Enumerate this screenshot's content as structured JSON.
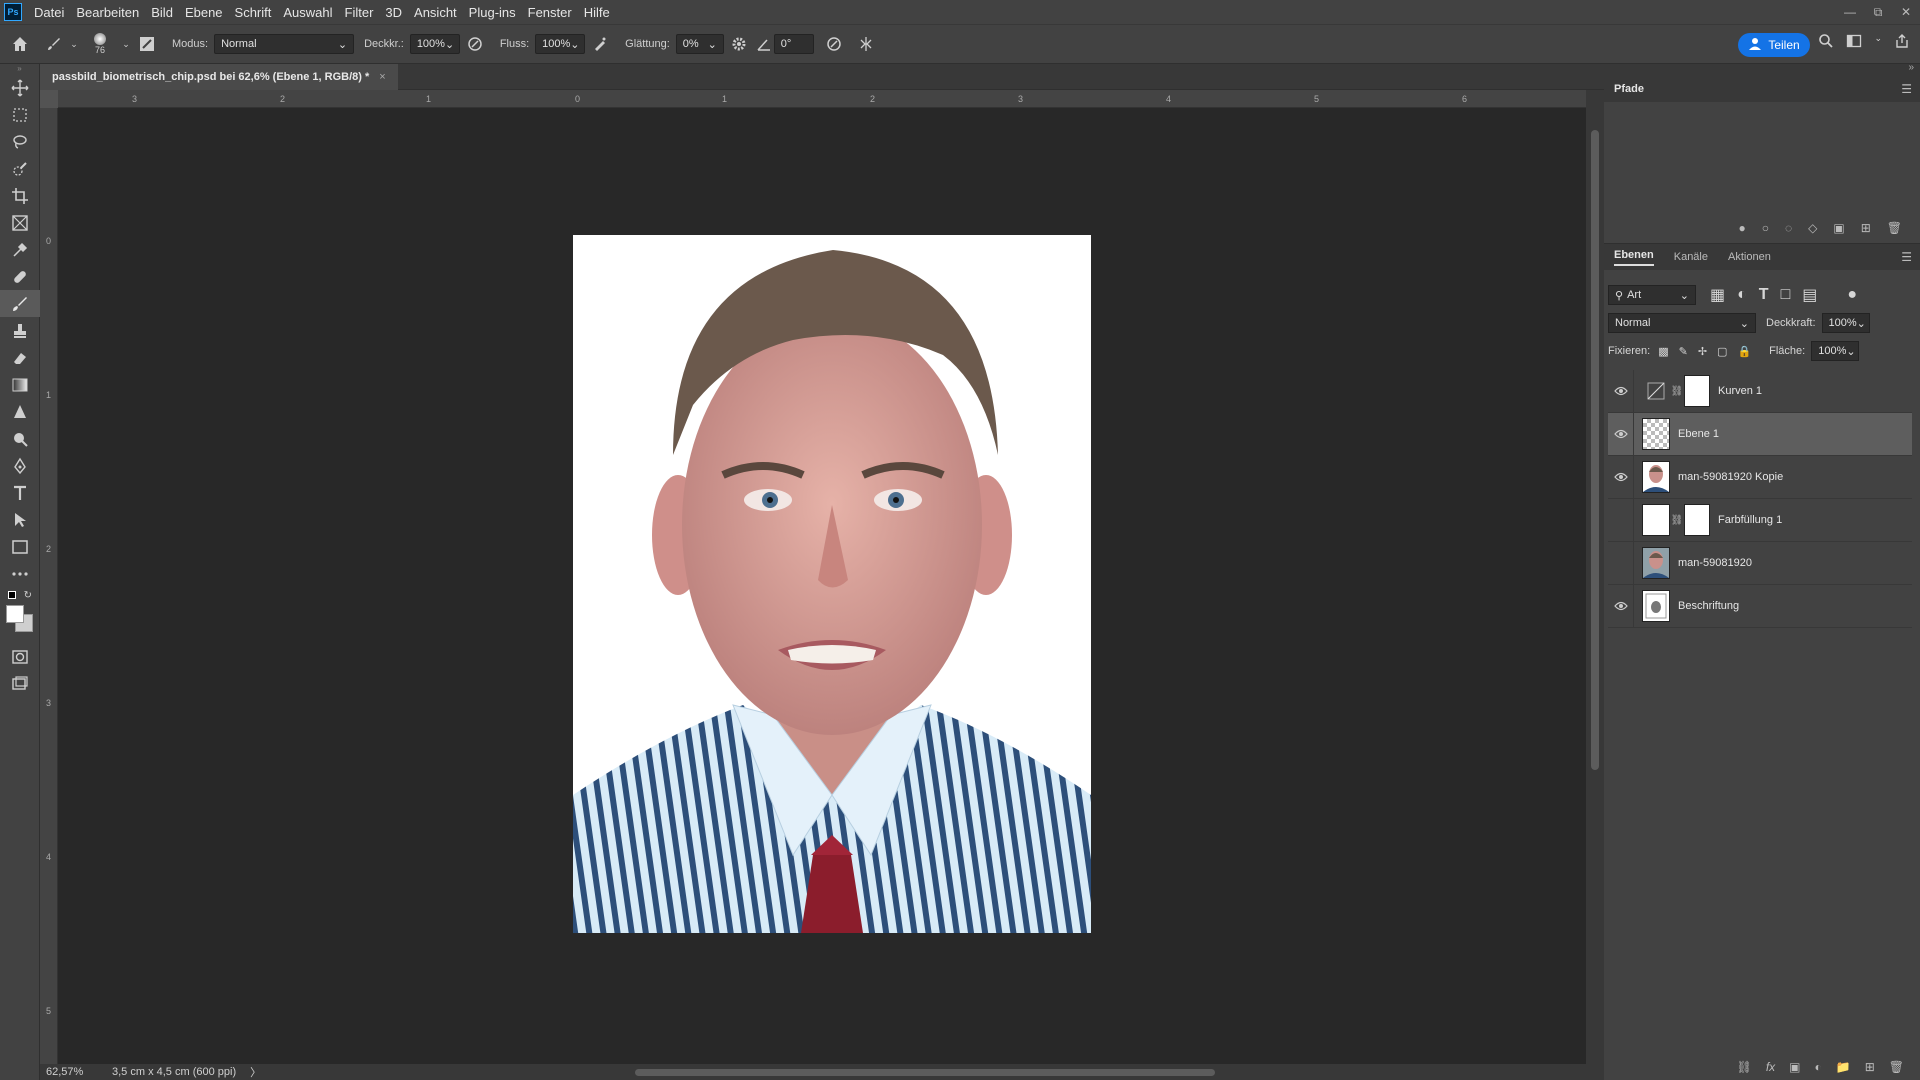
{
  "app": {
    "logo": "Ps"
  },
  "menu": [
    "Datei",
    "Bearbeiten",
    "Bild",
    "Ebene",
    "Schrift",
    "Auswahl",
    "Filter",
    "3D",
    "Ansicht",
    "Plug-ins",
    "Fenster",
    "Hilfe"
  ],
  "options": {
    "brush_size": "76",
    "mode_label": "Modus:",
    "mode_value": "Normal",
    "opacity_label": "Deckkr.:",
    "opacity_value": "100%",
    "flow_label": "Fluss:",
    "flow_value": "100%",
    "smoothing_label": "Glättung:",
    "smoothing_value": "0%",
    "angle_value": "0°",
    "share_label": "Teilen"
  },
  "document": {
    "tab_title": "passbild_biometrisch_chip.psd bei 62,6% (Ebene 1, RGB/8) *",
    "close": "×"
  },
  "ruler_top": [
    "3",
    "2",
    "1",
    "0",
    "1",
    "2",
    "3",
    "4",
    "5",
    "6"
  ],
  "ruler_left": [
    "0",
    "1",
    "2",
    "3",
    "4",
    "5"
  ],
  "status": {
    "zoom": "62,57%",
    "doc_info": "3,5 cm x 4,5 cm (600 ppi)",
    "arrow": "〉"
  },
  "paths_panel": {
    "title": "Pfade"
  },
  "layers_panel": {
    "tabs": [
      "Ebenen",
      "Kanäle",
      "Aktionen"
    ],
    "filter_value": "Art",
    "blend_mode": "Normal",
    "opacity_label": "Deckkraft:",
    "opacity_value": "100%",
    "lock_label": "Fixieren:",
    "fill_label": "Fläche:",
    "fill_value": "100%",
    "layers": [
      {
        "name": "Kurven 1",
        "visible": true
      },
      {
        "name": "Ebene 1",
        "visible": true
      },
      {
        "name": "man-59081920 Kopie",
        "visible": true
      },
      {
        "name": "Farbfüllung 1",
        "visible": false
      },
      {
        "name": "man-59081920",
        "visible": false
      },
      {
        "name": "Beschriftung",
        "visible": true
      }
    ]
  },
  "colors": {
    "accent": "#1473e6",
    "panel_bg": "#424242",
    "canvas_bg": "#282828"
  },
  "icons": [
    "home-icon",
    "brush-icon",
    "airbrush-icon",
    "gear-icon",
    "angle-icon",
    "search-icon",
    "eye-icon",
    "link-icon",
    "lock-icon"
  ]
}
